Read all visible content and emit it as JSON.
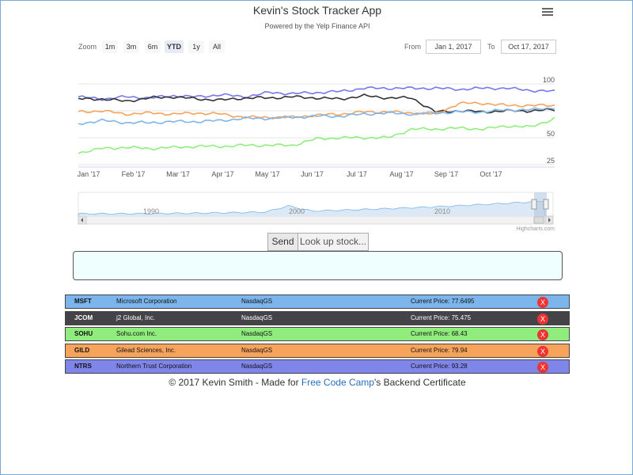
{
  "app": {
    "title": "Kevin's Stock Tracker App",
    "subtitle": "Powered by the Yelp Finance API"
  },
  "icons": {
    "menu": "hamburger-menu-icon",
    "delete": "close-x-icon"
  },
  "range": {
    "zoom_label": "Zoom",
    "buttons": [
      "1m",
      "3m",
      "6m",
      "YTD",
      "1y",
      "All"
    ],
    "active": "YTD",
    "from_label": "From",
    "from_value": "Jan 1, 2017",
    "to_label": "To",
    "to_value": "Oct 17, 2017"
  },
  "chart_data": {
    "type": "line",
    "x_labels": [
      "Jan '17",
      "Feb '17",
      "Mar '17",
      "Apr '17",
      "May '17",
      "Jun '17",
      "Jul '17",
      "Aug '17",
      "Sep '17",
      "Oct '17"
    ],
    "y_ticks": [
      100,
      50,
      25
    ],
    "series": [
      {
        "symbol": "NTRS",
        "color": "#7777ee",
        "values": [
          88,
          86,
          88,
          87,
          89,
          88,
          90,
          88,
          92,
          91,
          92,
          93,
          96,
          96,
          96,
          96,
          95,
          96,
          96,
          94,
          93
        ]
      },
      {
        "symbol": "JCOM",
        "color": "#333333",
        "values": [
          86,
          86,
          84,
          87,
          88,
          86,
          85,
          87,
          87,
          88,
          87,
          86,
          89,
          87,
          87,
          74,
          75,
          74,
          75,
          75,
          76
        ]
      },
      {
        "symbol": "GILD",
        "color": "#f7a35c",
        "values": [
          74,
          75,
          72,
          73,
          72,
          73,
          72,
          69,
          69,
          69,
          71,
          72,
          74,
          74,
          73,
          72,
          82,
          82,
          80,
          80,
          80
        ]
      },
      {
        "symbol": "MSFT",
        "color": "#7cb5ec",
        "values": [
          63,
          66,
          64,
          64,
          65,
          65,
          66,
          68,
          68,
          69,
          70,
          70,
          72,
          73,
          72,
          73,
          74,
          74,
          76,
          76,
          78
        ]
      },
      {
        "symbol": "SOHU",
        "color": "#90ed7d",
        "values": [
          36,
          40,
          41,
          40,
          41,
          42,
          42,
          43,
          43,
          43,
          49,
          50,
          50,
          50,
          58,
          58,
          59,
          58,
          61,
          60,
          68
        ]
      }
    ],
    "navigator": {
      "labels": [
        "1990",
        "2000",
        "2010"
      ]
    },
    "credits": "Highcharts.com"
  },
  "controls": {
    "send_label": "Send",
    "search_placeholder": "Look up stock..."
  },
  "stocks": [
    {
      "symbol": "MSFT",
      "name": "Microsoft Corporation",
      "exchange": "NasdaqGS",
      "price": "Current Price: 77.6495",
      "color": "#7cb5ec",
      "text_color": "#111"
    },
    {
      "symbol": "JCOM",
      "name": "j2 Global, Inc.",
      "exchange": "NasdaqGS",
      "price": "Current Price: 75.475",
      "color": "#434348",
      "text_color": "#fff"
    },
    {
      "symbol": "SOHU",
      "name": "Sohu.com Inc.",
      "exchange": "NasdaqGS",
      "price": "Current Price: 68.43",
      "color": "#90ed7d",
      "text_color": "#111"
    },
    {
      "symbol": "GILD",
      "name": "Gilead Sciences, Inc.",
      "exchange": "NasdaqGS",
      "price": "Current Price: 79.94",
      "color": "#f7a35c",
      "text_color": "#111"
    },
    {
      "symbol": "NTRS",
      "name": "Northern Trust Corporation",
      "exchange": "NasdaqGS",
      "price": "Current Price: 93.28",
      "color": "#8085e9",
      "text_color": "#111"
    }
  ],
  "delete_label": "X",
  "footer": {
    "prefix": "© 2017 Kevin Smith - Made for ",
    "link": "Free Code Camp",
    "suffix": "'s Backend Certificate"
  }
}
